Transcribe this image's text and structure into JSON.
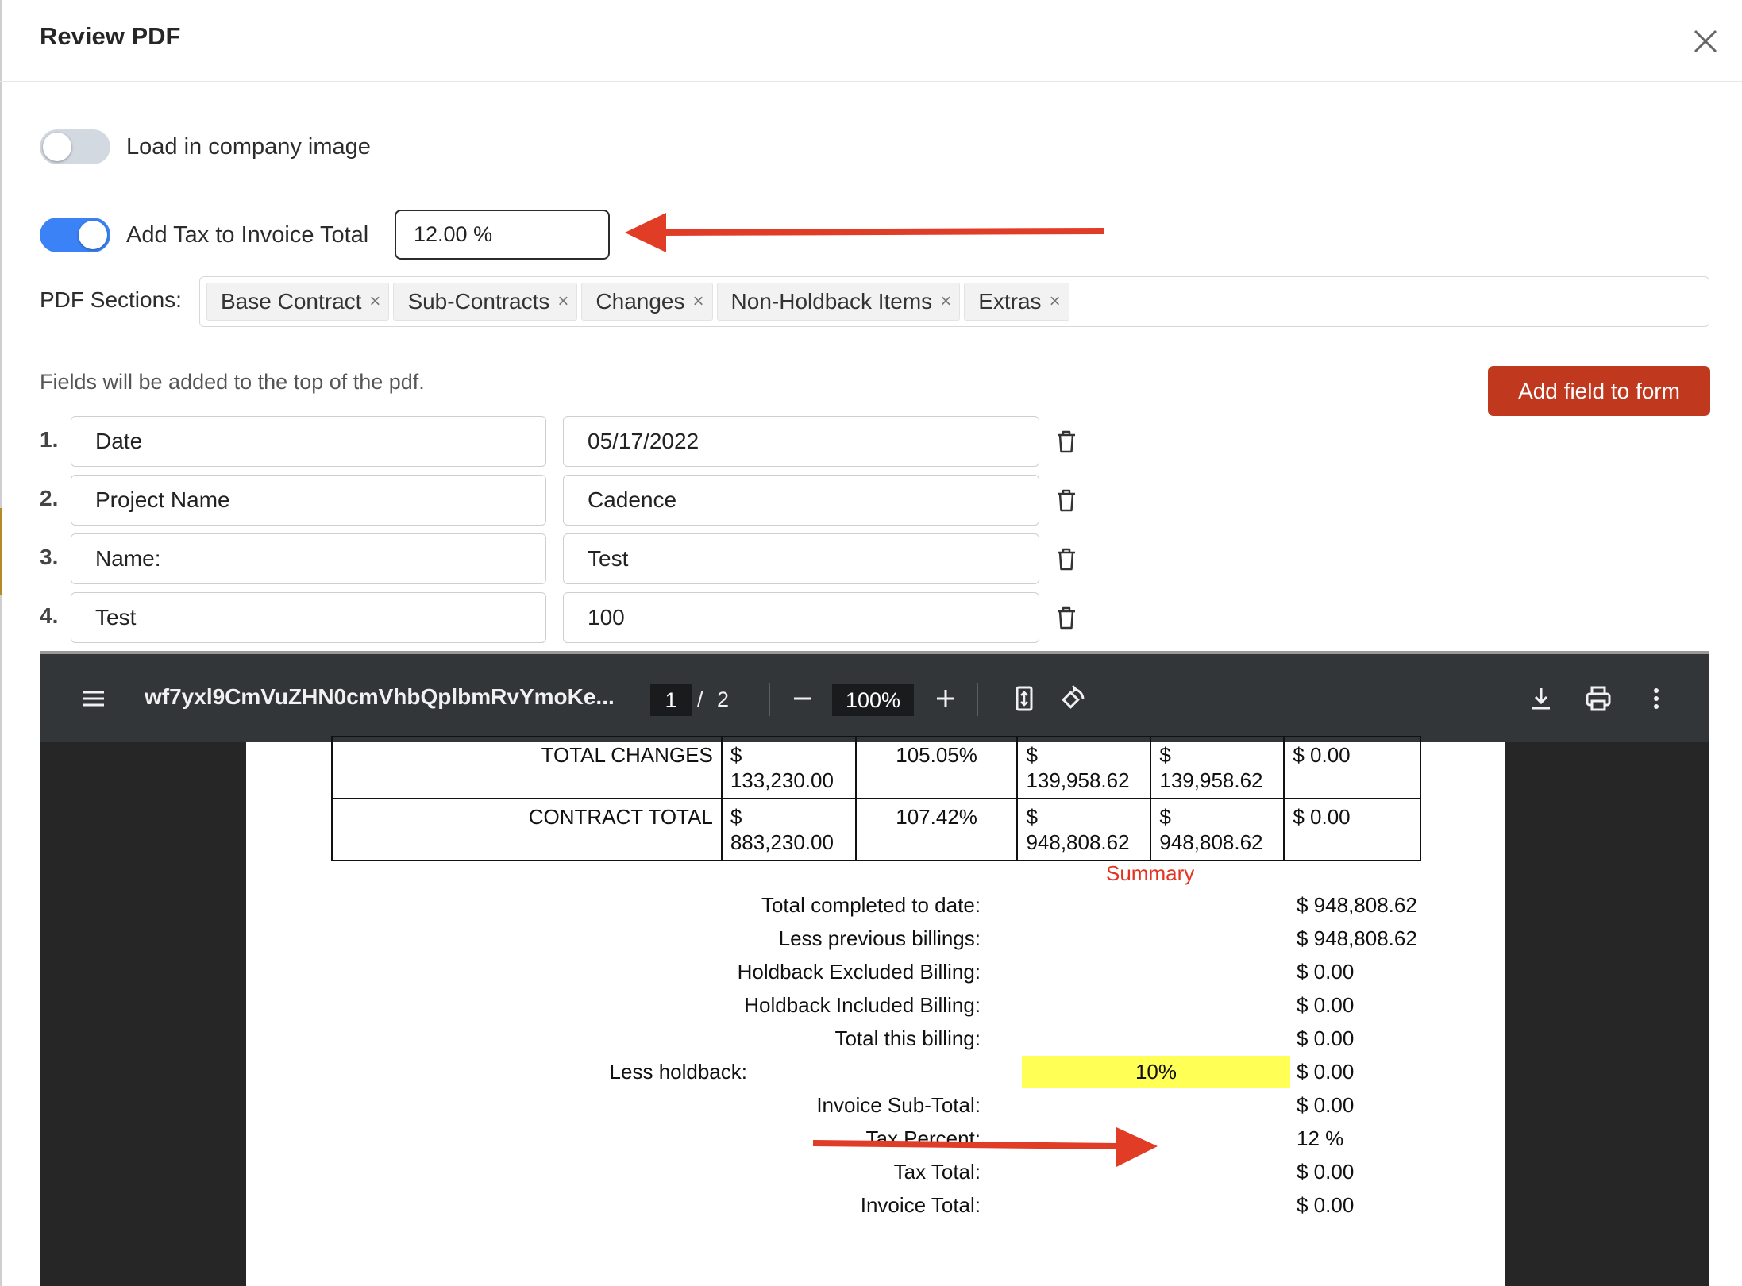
{
  "modal": {
    "title": "Review PDF"
  },
  "toggles": {
    "company_image": {
      "label": "Load in company image",
      "on": false
    },
    "add_tax": {
      "label": "Add Tax to Invoice Total",
      "on": true,
      "value": "12.00 %"
    }
  },
  "sections": {
    "label": "PDF Sections",
    "colon": ":",
    "tags": [
      "Base Contract",
      "Sub-Contracts",
      "Changes",
      "Non-Holdback Items",
      "Extras"
    ],
    "remove_glyph": "×"
  },
  "fields": {
    "note": "Fields will be added to the top of the pdf.",
    "add_button": "Add field to form",
    "rows": [
      {
        "num": "1.",
        "key": "Date",
        "value": "05/17/2022"
      },
      {
        "num": "2.",
        "key": "Project Name",
        "value": "Cadence"
      },
      {
        "num": "3.",
        "key": "Name:",
        "value": "Test"
      },
      {
        "num": "4.",
        "key": "Test",
        "value": "100"
      }
    ]
  },
  "viewer": {
    "filename": "wf7yxl9CmVuZHN0cmVhbQplbmRvYmoKe...",
    "page_current": "1",
    "page_sep": "/",
    "page_total": "2",
    "zoom": "100%",
    "icons": [
      "menu-icon",
      "zoom-out-icon",
      "zoom-in-icon",
      "fit-page-icon",
      "rotate-icon",
      "download-icon",
      "print-icon",
      "more-icon"
    ]
  },
  "pdf": {
    "table_rows": [
      {
        "label": "TOTAL CHANGES",
        "c1a": "$",
        "c1b": "133,230.00",
        "pct": "105.05%",
        "c3a": "$",
        "c3b": "139,958.62",
        "c4a": "$",
        "c4b": "139,958.62",
        "c5": "$ 0.00"
      },
      {
        "label": "CONTRACT TOTAL",
        "c1a": "$",
        "c1b": "883,230.00",
        "pct": "107.42%",
        "c3a": "$",
        "c3b": "948,808.62",
        "c4a": "$",
        "c4b": "948,808.62",
        "c5": "$ 0.00"
      }
    ],
    "summary_title": "Summary",
    "summary": [
      {
        "k": "Total completed to date:",
        "v": "$ 948,808.62"
      },
      {
        "k": "Less previous billings:",
        "v": "$ 948,808.62"
      },
      {
        "k": "Holdback Excluded Billing:",
        "v": "$ 0.00"
      },
      {
        "k": "Holdback Included Billing:",
        "v": "$ 0.00"
      },
      {
        "k": "Total this billing:",
        "v": "$ 0.00"
      }
    ],
    "holdback": {
      "k": "Less holdback:",
      "pct": "10%",
      "v": "$ 0.00"
    },
    "summary_after": [
      {
        "k": "Invoice Sub-Total:",
        "v": "$ 0.00"
      },
      {
        "k": "Tax Percent:",
        "v": "12 %"
      },
      {
        "k": "Tax Total:",
        "v": "$ 0.00"
      },
      {
        "k": "Invoice Total:",
        "v": "$ 0.00"
      }
    ]
  },
  "colors": {
    "accent_blue": "#3b82f6",
    "button_red": "#c0391f",
    "annotation_red": "#e03c26",
    "summary_red": "#e53322",
    "highlight_yellow": "#ffff55",
    "viewer_dark": "#323639"
  }
}
